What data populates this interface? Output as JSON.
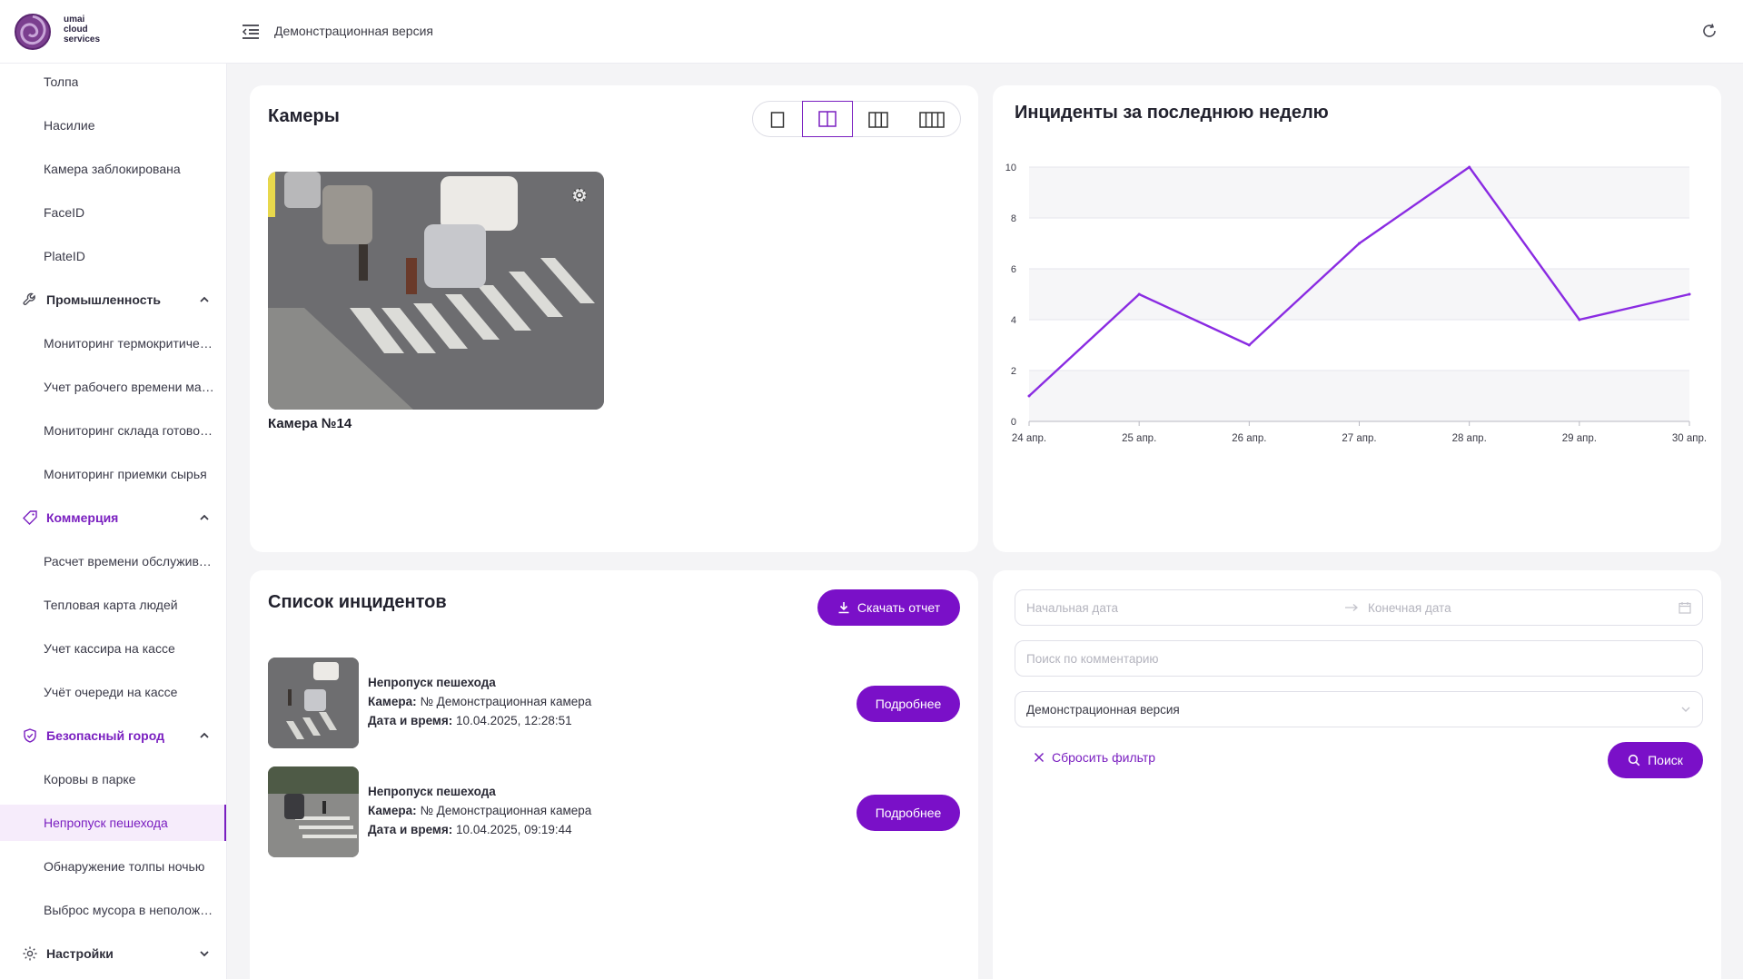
{
  "header": {
    "logo_text": "umai\ncloud\nservices",
    "title": "Демонстрационная версия"
  },
  "sidebar": {
    "items": [
      {
        "label": "Толпа",
        "kind": "item"
      },
      {
        "label": "Насилие",
        "kind": "item"
      },
      {
        "label": "Камера заблокирована",
        "kind": "item"
      },
      {
        "label": "FaceID",
        "kind": "item"
      },
      {
        "label": "PlateID",
        "kind": "item"
      },
      {
        "label": "Промышленность",
        "kind": "group",
        "icon": "wrench-icon"
      },
      {
        "label": "Мониторинг термокритических зон",
        "kind": "item"
      },
      {
        "label": "Учет рабочего времени мастеров",
        "kind": "item"
      },
      {
        "label": "Мониторинг склада готовой продукции",
        "kind": "item"
      },
      {
        "label": "Мониторинг приемки сырья",
        "kind": "item"
      },
      {
        "label": "Коммерция",
        "kind": "group",
        "icon": "tag-icon"
      },
      {
        "label": "Расчет времени обслуживания",
        "kind": "item"
      },
      {
        "label": "Тепловая карта людей",
        "kind": "item"
      },
      {
        "label": "Учет кассира на кассе",
        "kind": "item"
      },
      {
        "label": "Учёт очереди на кассе",
        "kind": "item"
      },
      {
        "label": "Безопасный город",
        "kind": "group",
        "icon": "shield-icon"
      },
      {
        "label": "Коровы в парке",
        "kind": "item"
      },
      {
        "label": "Непропуск пешехода",
        "kind": "item",
        "active": true
      },
      {
        "label": "Обнаружение толпы ночью",
        "kind": "item"
      },
      {
        "label": "Выброс мусора в неположенном месте",
        "kind": "item"
      },
      {
        "label": "Настройки",
        "kind": "group",
        "icon": "gear-icon"
      }
    ]
  },
  "cameras": {
    "title": "Камеры",
    "layout_options": [
      "1 column",
      "2 columns",
      "3 columns",
      "4 columns"
    ],
    "selected_layout": "2 columns",
    "camera_name": "Камера №14"
  },
  "chart_data": {
    "type": "line",
    "title": "Инциденты за последнюю неделю",
    "x": [
      "24 апр.",
      "25 апр.",
      "26 апр.",
      "27 апр.",
      "28 апр.",
      "29 апр.",
      "30 апр."
    ],
    "series": [
      {
        "values": [
          1,
          5,
          3,
          7,
          10,
          4,
          5
        ]
      }
    ],
    "ylim": [
      0,
      10
    ],
    "yticks": [
      0,
      2,
      4,
      6,
      8,
      10
    ],
    "grid": true,
    "color": "#8a2be2"
  },
  "incidents": {
    "title": "Список инцидентов",
    "download_label": "Скачать отчет",
    "details_label": "Подробнее",
    "camera_prefix": "Камера:",
    "datetime_prefix": "Дата и время:",
    "list": [
      {
        "type": "Непропуск пешехода",
        "camera": "№ Демонстрационная камера",
        "datetime": "10.04.2025, 12:28:51"
      },
      {
        "type": "Непропуск пешехода",
        "camera": "№ Демонстрационная камера",
        "datetime": "10.04.2025, 09:19:44"
      }
    ]
  },
  "filter": {
    "start_placeholder": "Начальная дата",
    "end_placeholder": "Конечная дата",
    "comment_placeholder": "Поиск по комментарию",
    "project_value": "Демонстрационная версия",
    "reset_label": "Сбросить фильтр",
    "search_label": "Поиск"
  },
  "colors": {
    "accent": "#7a10c8",
    "line": "#8a2be2"
  }
}
